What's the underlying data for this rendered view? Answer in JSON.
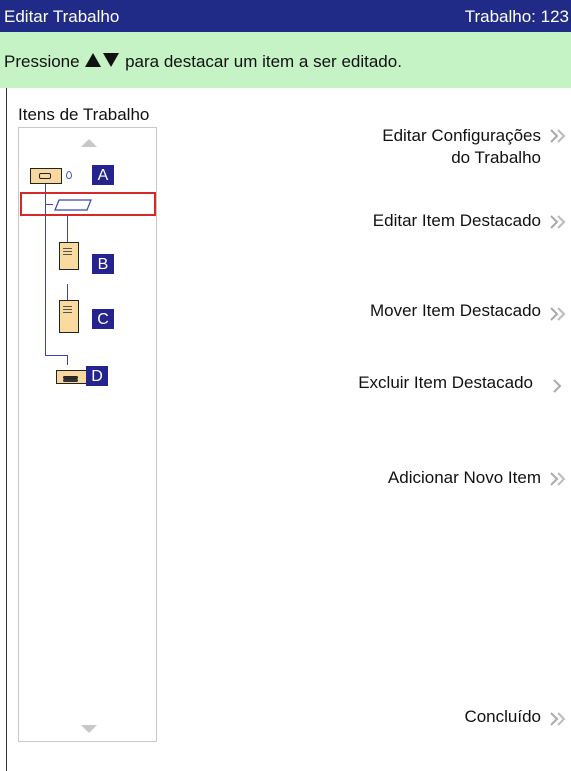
{
  "header": {
    "title": "Editar Trabalho",
    "job": "Trabalho: 123"
  },
  "instruction": {
    "before": "Pressione",
    "after": "para destacar um item a ser editado."
  },
  "list": {
    "title": "Itens de Trabalho",
    "badges": [
      "A",
      "B",
      "C",
      "D"
    ]
  },
  "actions": {
    "edit_settings_line1": "Editar Configurações",
    "edit_settings_line2": "do Trabalho",
    "edit_item": "Editar Item Destacado",
    "move_item": "Mover Item Destacado",
    "delete_item": "Excluir Item Destacado",
    "add_item": "Adicionar Novo Item",
    "done": "Concluído"
  },
  "colors": {
    "titlebar": "#1f2b86",
    "instruction_bg": "#c6f3c6",
    "badge": "#25248f",
    "highlight": "#d62828"
  }
}
